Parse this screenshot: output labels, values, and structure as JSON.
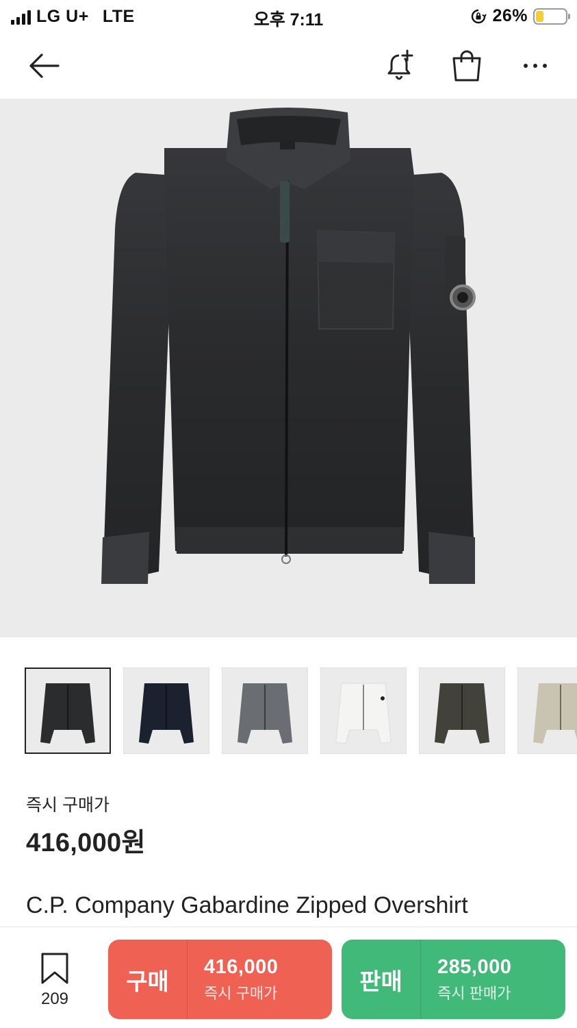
{
  "status_bar": {
    "carrier": "LG U+",
    "network": "LTE",
    "time": "오후 7:11",
    "battery_percent": "26%",
    "battery_level": 0.26
  },
  "nav": {
    "back_icon": "arrow-left-icon",
    "alert_icon": "bell-plus-icon",
    "cart_icon": "shopping-bag-icon",
    "more_icon": "more-dots-icon"
  },
  "gallery": {
    "thumbnails": [
      {
        "color": "#2b2c2e",
        "selected": true
      },
      {
        "color": "#1c2130",
        "selected": false
      },
      {
        "color": "#6a6d71",
        "selected": false
      },
      {
        "color": "#f4f4f2",
        "selected": false
      },
      {
        "color": "#42423a",
        "selected": false
      },
      {
        "color": "#c9c4b2",
        "selected": false
      }
    ]
  },
  "price": {
    "label": "즉시 구매가",
    "value": "416,000원"
  },
  "product": {
    "name": "C.P. Company Gabardine Zipped Overshirt"
  },
  "bottom_bar": {
    "wishlist_count": "209",
    "buy": {
      "label": "구매",
      "price": "416,000",
      "sub": "즉시 구매가",
      "color": "#ef6253"
    },
    "sell": {
      "label": "판매",
      "price": "285,000",
      "sub": "즉시 판매가",
      "color": "#41b979"
    }
  }
}
